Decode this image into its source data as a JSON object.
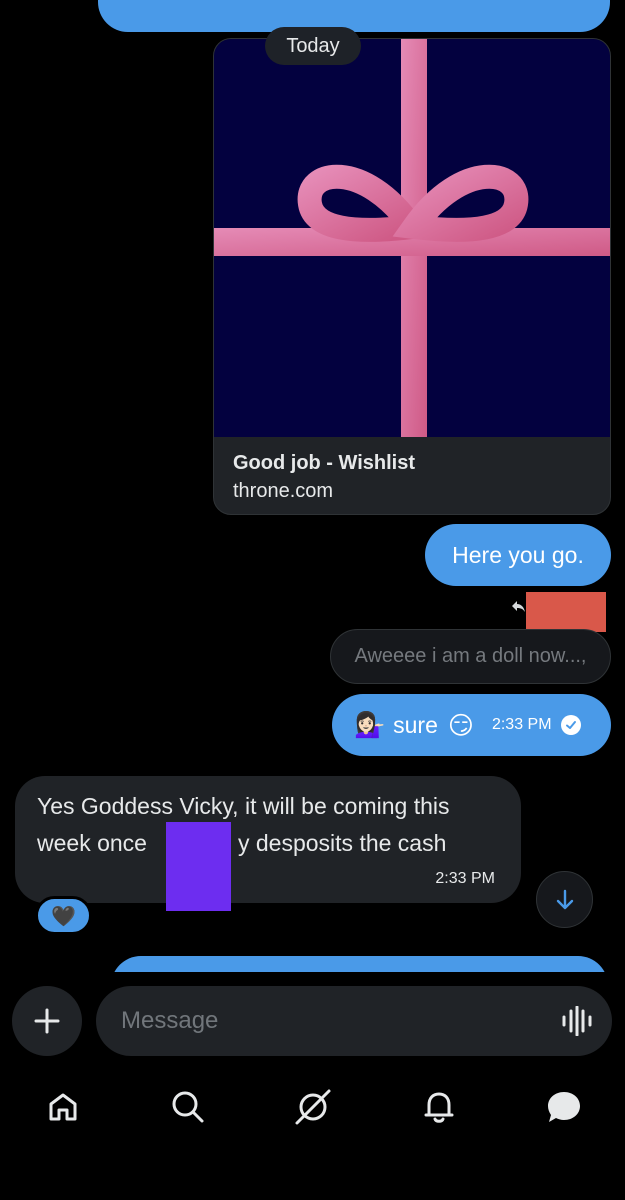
{
  "chat": {
    "date_divider": "Today",
    "link_card": {
      "title": "Good job  - Wishlist",
      "domain": "throne.com"
    },
    "sent_here": "Here you go.",
    "quoted_reply": "Aweeee i am a doll now...,",
    "sent_sure": {
      "emoji_left": "💁🏻‍♀️",
      "text": "sure",
      "emoji_right": "😏",
      "time": "2:33 PM"
    },
    "received": {
      "line1": "Yes Goddess Vicky, it will be coming this",
      "line2_before": "week once",
      "line2_after": "y desposits the cash",
      "time": "2:33 PM",
      "reaction": "🖤"
    }
  },
  "composer": {
    "placeholder": "Message"
  },
  "tabs": [
    {
      "icon": "home-icon"
    },
    {
      "icon": "search-icon"
    },
    {
      "icon": "grok-icon"
    },
    {
      "icon": "bell-icon"
    },
    {
      "icon": "messages-icon"
    }
  ],
  "colors": {
    "accent": "#4a9ae8",
    "bubble_dark": "#202327",
    "gift_bg": "#03013f",
    "ribbon": "#e07aa8",
    "redact_red": "#d9584a",
    "redact_purple": "#6d2df0"
  }
}
